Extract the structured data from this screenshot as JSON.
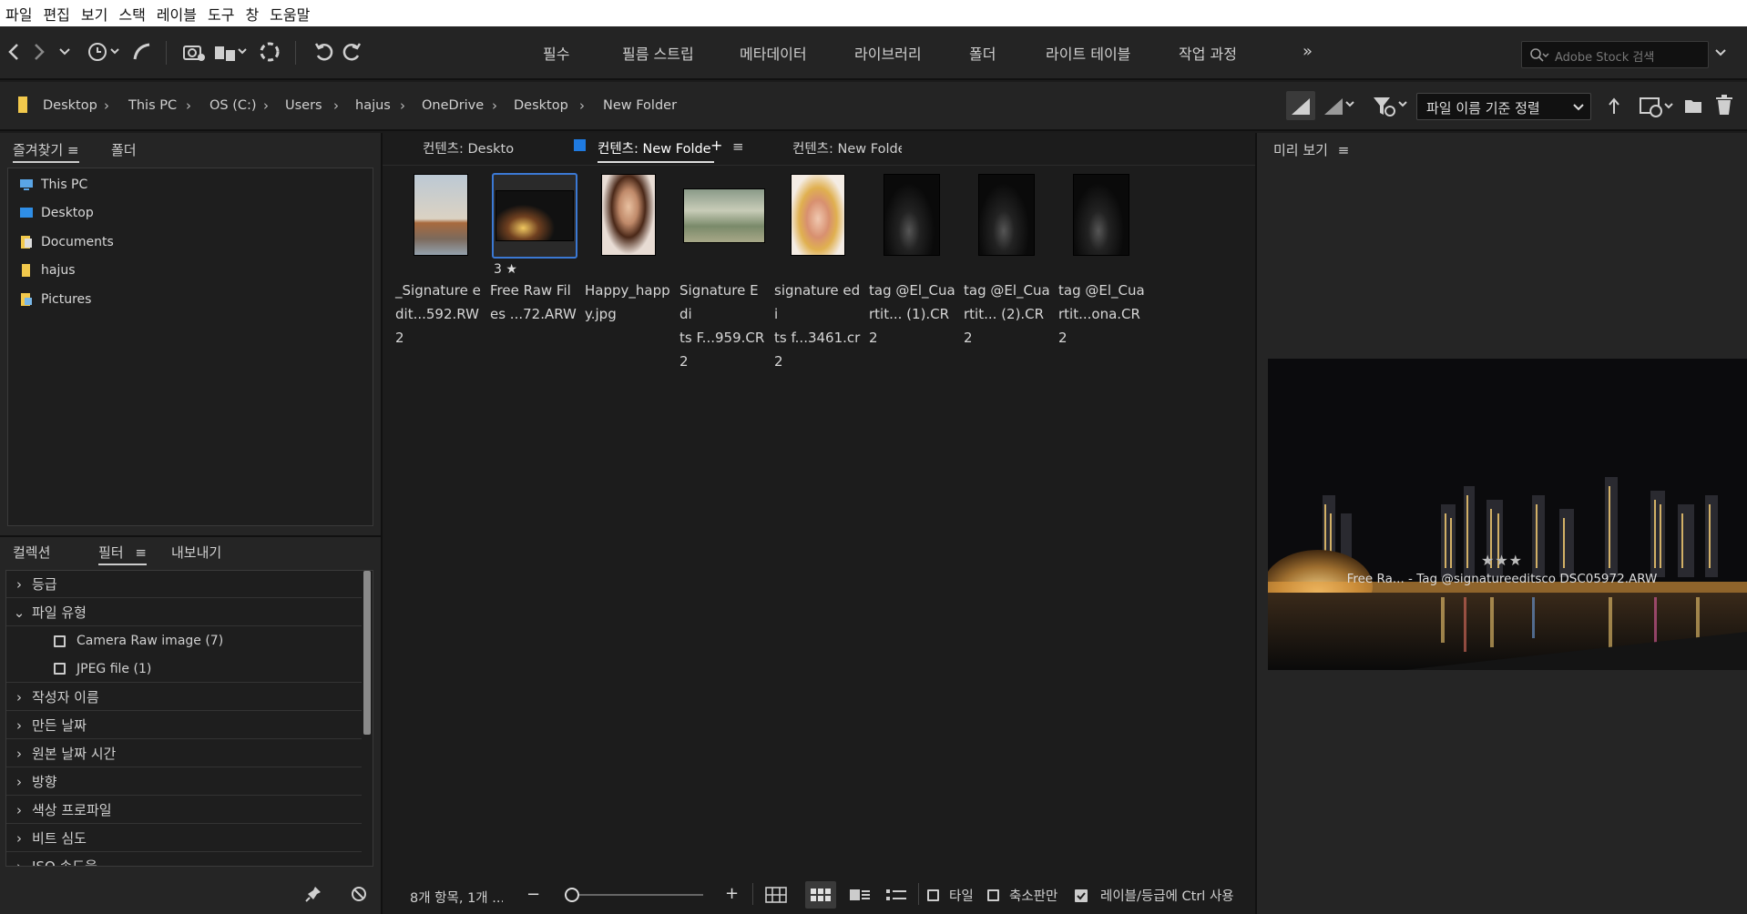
{
  "menu": [
    "파일",
    "편집",
    "보기",
    "스택",
    "레이블",
    "도구",
    "창",
    "도움말"
  ],
  "workspaces": [
    "필수",
    "필름 스트립",
    "메타데이터",
    "라이브러리",
    "폴더",
    "라이트 테이블",
    "작업 과정"
  ],
  "search_placeholder": "Adobe Stock 검색",
  "breadcrumb": [
    "Desktop",
    "This PC",
    "OS (C:)",
    "Users",
    "hajus",
    "OneDrive",
    "Desktop",
    "New Folder"
  ],
  "sort_label": "파일 이름 기준 정렬",
  "left_tabs": {
    "favorites": "즐겨찾기",
    "folders": "폴더"
  },
  "favorites": [
    "This PC",
    "Desktop",
    "Documents",
    "hajus",
    "Pictures"
  ],
  "lower_tabs": {
    "collections": "컬렉션",
    "filter": "필터",
    "export": "내보내기"
  },
  "filters": [
    {
      "label": "등급",
      "expanded": false
    },
    {
      "label": "파일 유형",
      "expanded": true
    },
    {
      "label": "Camera Raw image  (7)",
      "child": true
    },
    {
      "label": "JPEG file  (1)",
      "child": true
    },
    {
      "label": "작성자 이름",
      "expanded": false
    },
    {
      "label": "만든 날짜",
      "expanded": false
    },
    {
      "label": "원본 날짜 시간",
      "expanded": false
    },
    {
      "label": "방향",
      "expanded": false
    },
    {
      "label": "색상 프로파일",
      "expanded": false
    },
    {
      "label": "비트 심도",
      "expanded": false
    },
    {
      "label": "ISO 속도율",
      "expanded": false
    }
  ],
  "content_tabs": [
    "컨텐츠: Desktop",
    "컨텐츠: New Folde",
    "컨텐츠: New Folde"
  ],
  "thumbnails": [
    {
      "name1": "_Signature e",
      "name2": "dit...592.RW2"
    },
    {
      "name1": "Free Raw Fil",
      "name2": "es ...72.ARW",
      "rating": "3",
      "selected": true
    },
    {
      "name1": "Happy_happ",
      "name2": "y.jpg"
    },
    {
      "name1": "Signature Edi",
      "name2": "ts F...959.CR2"
    },
    {
      "name1": "signature edi",
      "name2": "ts f...3461.cr2"
    },
    {
      "name1": "tag @El_Cua",
      "name2": "rtit... (1).CR2"
    },
    {
      "name1": "tag @El_Cua",
      "name2": "rtit... (2).CR2"
    },
    {
      "name1": "tag @El_Cua",
      "name2": "rtit...ona.CR2"
    }
  ],
  "status_text": "8개 항목, 1개 ...",
  "bottom_options": {
    "tile": "타일",
    "compact": "축소판만",
    "labels": "레이블/등급에 Ctrl 사용"
  },
  "preview_tab": "미리 보기",
  "preview_caption": "Free Ra... - Tag @signatureeditsco DSC05972.ARW",
  "preview_rating": 3
}
